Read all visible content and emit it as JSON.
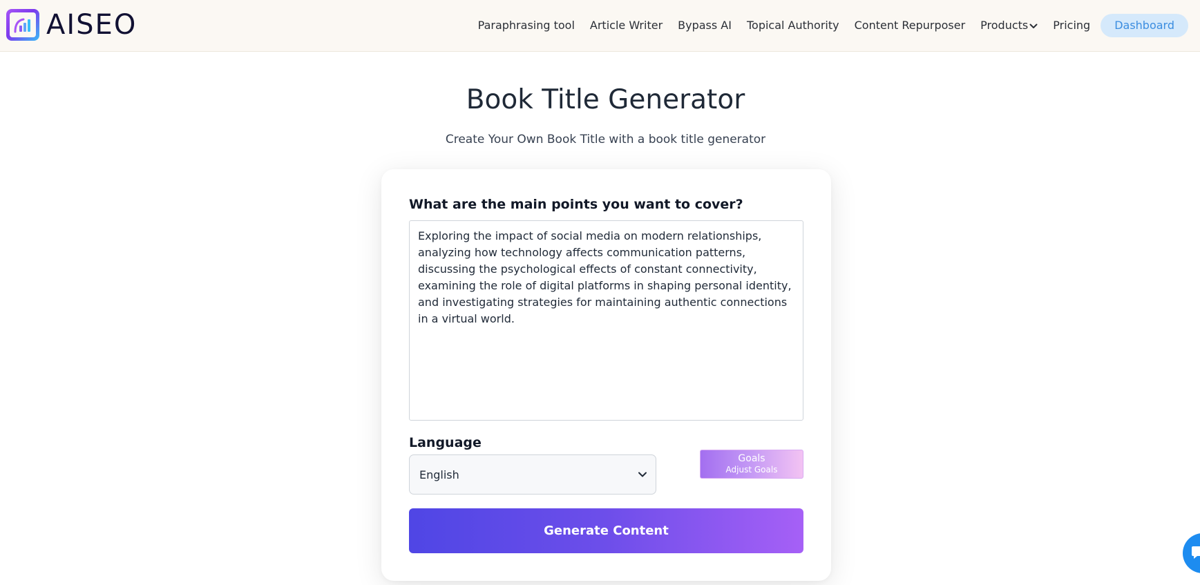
{
  "brand": {
    "name": "AISEO"
  },
  "nav": {
    "links": [
      "Paraphrasing tool",
      "Article Writer",
      "Bypass AI",
      "Topical Authority",
      "Content Repurposer",
      "Products",
      "Pricing"
    ],
    "dashboard_label": "Dashboard"
  },
  "page": {
    "title": "Book Title Generator",
    "subtitle": "Create Your Own Book Title with a book title generator"
  },
  "form": {
    "points_label": "What are the main points you want to cover?",
    "points_value": "Exploring the impact of social media on modern relationships, analyzing how technology affects communication patterns, discussing the psychological effects of constant connectivity, examining the role of digital platforms in shaping personal identity, and investigating strategies for maintaining authentic connections in a virtual world.",
    "language_label": "Language",
    "language_value": "English",
    "goals_title": "Goals",
    "goals_subtitle": "Adjust Goals",
    "generate_label": "Generate Content"
  },
  "colors": {
    "nav_bg": "#fbf8f3",
    "dashboard_bg": "#d5e9fb",
    "dashboard_text": "#3b8de0",
    "generate_start": "#4f46e5",
    "generate_end": "#a660f6",
    "chat_fab": "#1d8cf0"
  },
  "icons": {
    "logo": "bar-chart-logo-icon",
    "products_caret": "chevron-down-icon",
    "select_caret": "chevron-down-icon",
    "chat": "chat-bubble-icon"
  }
}
